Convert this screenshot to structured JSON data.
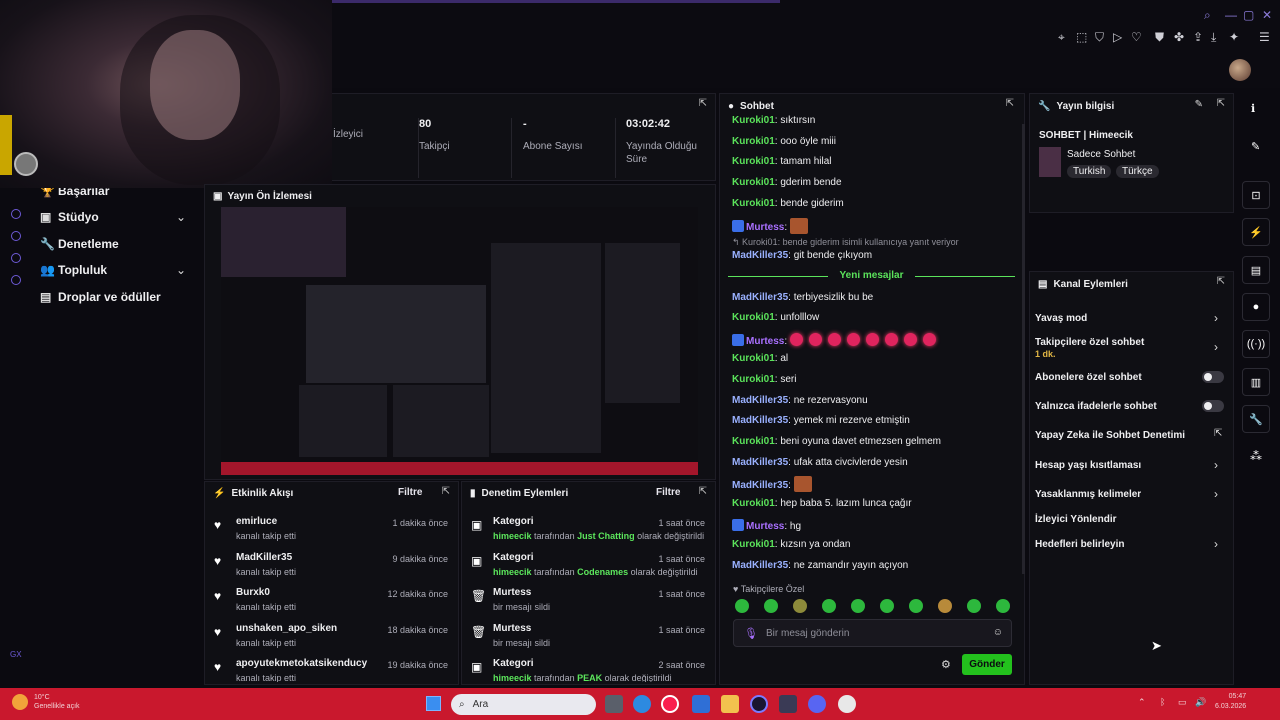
{
  "stream_stats": [
    {
      "value": "",
      "label": "İzleyici"
    },
    {
      "value": "80",
      "label": "Takipçi"
    },
    {
      "value": "-",
      "label": "Abone Sayısı"
    },
    {
      "value": "03:02:42",
      "label": "Yayında Olduğu Süre"
    }
  ],
  "nav": [
    {
      "label": "Başarılar",
      "icon": "trophy-icon"
    },
    {
      "label": "Stüdyo",
      "icon": "studio-icon"
    },
    {
      "label": "Denetleme",
      "icon": "wrench-icon"
    },
    {
      "label": "Topluluk",
      "icon": "community-icon"
    },
    {
      "label": "Droplar ve ödüller",
      "icon": "drops-icon"
    }
  ],
  "preview": {
    "title": "Yayın Ön İzlemesi"
  },
  "activity": {
    "title": "Etkinlik Akışı",
    "filter": "Filtre",
    "items": [
      {
        "name": "emirluce",
        "sub": "kanalı takip etti",
        "time": "1 dakika önce"
      },
      {
        "name": "MadKiller35",
        "sub": "kanalı takip etti",
        "time": "9 dakika önce"
      },
      {
        "name": "Burxk0",
        "sub": "kanalı takip etti",
        "time": "12 dakika önce"
      },
      {
        "name": "unshaken_apo_siken",
        "sub": "kanalı takip etti",
        "time": "18 dakika önce"
      },
      {
        "name": "apoyutekmetokatsikenducy",
        "sub": "kanalı takip etti",
        "time": "19 dakika önce"
      }
    ]
  },
  "moderation": {
    "title": "Denetim Eylemleri",
    "filter": "Filtre",
    "items": [
      {
        "name": "Kategori",
        "user": "himeecik",
        "pre": "tarafından",
        "hl": "Just Chatting",
        "post": "olarak değiştirildi",
        "time": "1 saat önce"
      },
      {
        "name": "Kategori",
        "user": "himeecik",
        "pre": "tarafından",
        "hl": "Codenames",
        "post": "olarak değiştirildi",
        "time": "1 saat önce"
      },
      {
        "name": "Murtess",
        "user": "",
        "pre": "bir mesajı sildi",
        "hl": "",
        "post": "",
        "time": "1 saat önce"
      },
      {
        "name": "Murtess",
        "user": "",
        "pre": "bir mesajı sildi",
        "hl": "",
        "post": "",
        "time": "1 saat önce"
      },
      {
        "name": "Kategori",
        "user": "himeecik",
        "pre": "tarafından",
        "hl": "PEAK",
        "post": "olarak değiştirildi",
        "time": "2 saat önce"
      }
    ]
  },
  "chat": {
    "title": "Sohbet",
    "reply_note": "Kuroki01: bende giderim isimli kullanıcıya yanıt veriyor",
    "new_messages": "Yeni mesajlar",
    "followers_only": "Takipçilere Özel",
    "input_placeholder": "Bir mesaj gönderin",
    "send": "Gönder",
    "messages": [
      {
        "user": "Kuroki01",
        "text": "sıktırsın"
      },
      {
        "user": "Kuroki01",
        "text": "ooo öyle miii"
      },
      {
        "user": "Kuroki01",
        "text": "tamam hilal"
      },
      {
        "user": "Kuroki01",
        "text": "gderim bende"
      },
      {
        "user": "Kuroki01",
        "text": "bende giderim"
      },
      {
        "user": "Murtess",
        "text": ""
      },
      {
        "user": "MadKiller35",
        "text": "git bende çıkıyom"
      },
      {
        "user": "MadKiller35",
        "text": "terbiyesizlik bu be"
      },
      {
        "user": "Kuroki01",
        "text": "unfolllow"
      },
      {
        "user": "Murtess",
        "text": ""
      },
      {
        "user": "Kuroki01",
        "text": "al"
      },
      {
        "user": "Kuroki01",
        "text": "seri"
      },
      {
        "user": "MadKiller35",
        "text": "ne rezervasyonu"
      },
      {
        "user": "MadKiller35",
        "text": "yemek mi rezerve etmiştin"
      },
      {
        "user": "Kuroki01",
        "text": "beni oyuna davet etmezsen gelmem"
      },
      {
        "user": "MadKiller35",
        "text": "ufak atta civcivlerde yesin"
      },
      {
        "user": "MadKiller35",
        "text": ""
      },
      {
        "user": "Kuroki01",
        "text": "hep baba 5. lazım lunca çağır"
      },
      {
        "user": "Murtess",
        "text": "hg"
      },
      {
        "user": "Kuroki01",
        "text": "kızsın ya ondan"
      },
      {
        "user": "MadKiller35",
        "text": "ne zamandır yayın açıyon"
      }
    ]
  },
  "stream_info": {
    "title": "Yayın bilgisi",
    "stream_title": "SOHBET | Himeecik",
    "category": "Sadece Sohbet",
    "tags": [
      "Turkish",
      "Türkçe"
    ]
  },
  "channel_actions": {
    "title": "Kanal Eylemleri",
    "items": [
      {
        "label": "Yavaş mod",
        "sub": ""
      },
      {
        "label": "Takipçilere özel sohbet",
        "sub": "1 dk."
      },
      {
        "label": "Abonelere özel sohbet",
        "sub": ""
      },
      {
        "label": "Yalnızca ifadelerle sohbet",
        "sub": ""
      },
      {
        "label": "Yapay Zeka ile Sohbet Denetimi",
        "sub": ""
      },
      {
        "label": "Hesap yaşı kısıtlaması",
        "sub": ""
      },
      {
        "label": "Yasaklanmış kelimeler",
        "sub": ""
      },
      {
        "label": "İzleyici Yönlendir",
        "sub": ""
      },
      {
        "label": "Hedefleri belirleyin",
        "sub": ""
      }
    ]
  },
  "taskbar": {
    "search": "Ara",
    "weather_temp": "10°C",
    "weather_desc": "Genellikle açık",
    "time": "05:47",
    "date": "6.03.2026"
  },
  "colors": {
    "accent": "#9147ff",
    "green": "#23c11d",
    "taskbar": "#c9182d"
  }
}
